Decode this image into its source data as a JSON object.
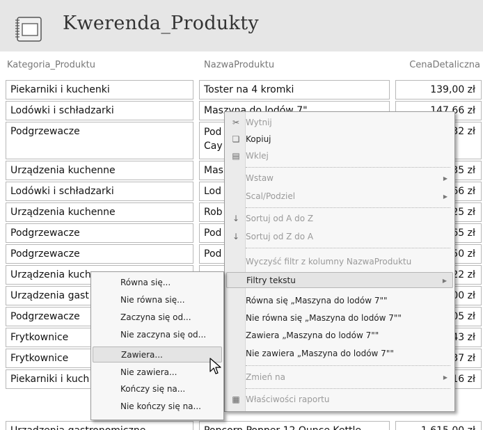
{
  "report": {
    "title": "Kwerenda_Produkty"
  },
  "columns": [
    "Kategoria_Produktu",
    "NazwaProduktu",
    "CenaDetaliczna"
  ],
  "rows": [
    {
      "category": "Piekarniki i kuchenki",
      "product": "Toster na 4 kromki",
      "price": "139,00 zł"
    },
    {
      "category": "Lodówki i schładzarki",
      "product": "Maszyna do lodów 7\"",
      "price": "147,66 zł"
    },
    {
      "category": "Podgrzewacze",
      "product": "Pod Cay",
      "price": "5,32 zł"
    },
    {
      "category": "Urządzenia kuchenne",
      "product": "Mas",
      "price": "9,35 zł"
    },
    {
      "category": "Lodówki i schładzarki",
      "product": "Lod",
      "price": "7,66 zł"
    },
    {
      "category": "Urządzenia kuchenne",
      "product": "Rob",
      "price": "6,25 zł"
    },
    {
      "category": "Podgrzewacze",
      "product": "Pod",
      "price": "3,65 zł"
    },
    {
      "category": "Podgrzewacze",
      "product": "Pod",
      "price": "8,50 zł"
    },
    {
      "category": "Urządzenia kuch",
      "product": "",
      "price": "4,22 zł"
    },
    {
      "category": "Urządzenia gast",
      "product": "",
      "price": "9,00 zł"
    },
    {
      "category": "Podgrzewacze",
      "product": "",
      "price": "2,05 zł"
    },
    {
      "category": "Frytkownice",
      "product": "",
      "price": "2,43 zł"
    },
    {
      "category": "Frytkownice",
      "product": "",
      "price": "3,37 zł"
    },
    {
      "category": "Piekarniki i kuch",
      "product": "",
      "price": "6,16 zł"
    },
    {
      "category": "Urządzenia gastronomiczne",
      "product": "Popcorn Popper 12 Ounce Kettle",
      "price": "1 615,00 zł"
    }
  ],
  "context_menu": {
    "items": [
      {
        "label": "Wytnij",
        "icon": "scissors-icon",
        "disabled": true
      },
      {
        "label": "Kopiuj",
        "icon": "copy-icon",
        "disabled": false
      },
      {
        "label": "Wklej",
        "icon": "paste-icon",
        "disabled": true
      },
      {
        "label": "Wstaw",
        "disabled": true,
        "submenu": true
      },
      {
        "label": "Scal/Podziel",
        "disabled": true,
        "submenu": true
      },
      {
        "label": "Sortuj od A do Z",
        "icon": "sort-ascending-icon",
        "disabled": true
      },
      {
        "label": "Sortuj od Z do A",
        "icon": "sort-descending-icon",
        "disabled": true
      },
      {
        "label": "Wyczyść filtr z kolumny NazwaProduktu",
        "disabled": true
      },
      {
        "label": "Filtry tekstu",
        "disabled": false,
        "submenu": true
      },
      {
        "label": "Równa się „Maszyna do lodów 7\"\"",
        "disabled": false
      },
      {
        "label": "Nie równa się „Maszyna do lodów 7\"\"",
        "disabled": false
      },
      {
        "label": "Zawiera „Maszyna do lodów 7\"\"",
        "disabled": false
      },
      {
        "label": "Nie zawiera „Maszyna do lodów 7\"\"",
        "disabled": false
      },
      {
        "label": "Zmień na",
        "disabled": true,
        "submenu": true
      },
      {
        "label": "Właściwości raportu",
        "icon": "properties-icon",
        "disabled": true
      }
    ]
  },
  "text_filters_submenu": {
    "items": [
      {
        "label": "Równa się..."
      },
      {
        "label": "Nie równa się..."
      },
      {
        "label": "Zaczyna się od..."
      },
      {
        "label": "Nie zaczyna się od..."
      },
      {
        "label": "Zawiera..."
      },
      {
        "label": "Nie zawiera..."
      },
      {
        "label": "Kończy się na..."
      },
      {
        "label": "Nie kończy się na..."
      }
    ]
  }
}
